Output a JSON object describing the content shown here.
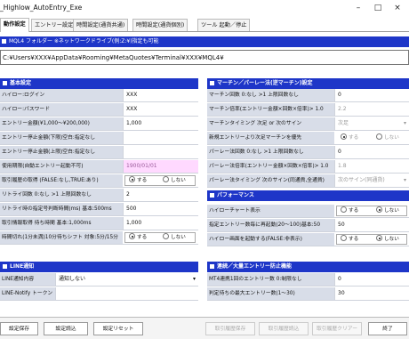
{
  "window": {
    "title": "_Highlow_AutoEntry_Exe",
    "min": "–",
    "max": "□",
    "close": "×"
  },
  "tabs": [
    "動作設定",
    "エントリー設定",
    "時間設定(通貨共通)",
    "時間設定(通貨個別)",
    "ツール 起動／停止"
  ],
  "folder": {
    "label": "MQL4 フォルダー ※ネットワークドライブ(例:Z:¥)指定も可能",
    "path": "C:¥Users¥XXX¥AppData¥Rooming¥MetaQuotes¥Terminal¥XXX¥MQL4¥"
  },
  "basic": {
    "title": "基本設定",
    "rows": [
      {
        "label": "ハイロー:ログイン",
        "value": "XXX"
      },
      {
        "label": "ハイロー:パスワード",
        "value": "XXX"
      },
      {
        "label": "エントリー金額(¥1,000〜¥200,000)",
        "value": "1,000"
      },
      {
        "label": "エントリー停止金額(下限)空白:指定なし",
        "value": ""
      },
      {
        "label": "エントリー停止金額(上限)空白:指定なし",
        "value": ""
      },
      {
        "label": "使用期限(自動エントリー起動不可)",
        "value": "1900/01/01"
      },
      {
        "label": "取引履歴の取得 (FALSE:なし,TRUE:あり)",
        "value": ""
      },
      {
        "label": "リトライ回数 0:なし >1 上限回数なし",
        "value": "2"
      },
      {
        "label": "リトライ時の指定号判断時間(ms) 基本:500ms",
        "value": "500"
      },
      {
        "label": "取引情報取得 待ち時間 基本:1,000ms",
        "value": "1,000"
      },
      {
        "label": "時間切れ(1分未満)10分待ちシフト 対象:5分/15分",
        "value": ""
      }
    ],
    "radio_on": "する",
    "radio_off": "しない"
  },
  "martingale": {
    "title": "マーチン／パーレー法(逆マーチン)設定",
    "rows": [
      {
        "label": "マーチン回数 0:なし >1 上限回数なし",
        "value": "0"
      },
      {
        "label": "マーチン倍率(エントリー金額×回数×倍率)> 1.0",
        "value": "2.2"
      },
      {
        "label": "マーチンタイミング 次足 or 次のサイン",
        "value": "次足"
      },
      {
        "label": "新規エントリーより次足マーチンを優先",
        "value": ""
      },
      {
        "label": "パーレー法回数 0:なし >1 上限回数なし",
        "value": "0"
      },
      {
        "label": "パーレー法倍率(エントリー金額×回数×倍率)> 1.0",
        "value": "1.8"
      },
      {
        "label": "パーレー法タイミング 次のサイン(同通貨,全通貨)",
        "value": "次のサイン(同通貨)"
      }
    ]
  },
  "performance": {
    "title": "パフォーマンス",
    "rows": [
      {
        "label": "ハイローチャート表示",
        "value": ""
      },
      {
        "label": "指定エントリー数毎に再起動(20〜100)基本:50",
        "value": "50"
      },
      {
        "label": "ハイロー画面を起動する(FALSE:非表示)",
        "value": ""
      }
    ]
  },
  "line": {
    "title": "LINE通知",
    "rows": [
      {
        "label": "LINE通知内容",
        "value": "通知しない"
      },
      {
        "label": "LINE-Notify トークン",
        "value": ""
      }
    ]
  },
  "consecutive": {
    "title": "連続／大量エントリー防止機能",
    "rows": [
      {
        "label": "MT4連携1回のエントリー数 0:制限なし",
        "value": "0"
      },
      {
        "label": "判定待ちの最大エントリー数(1〜30)",
        "value": "30"
      }
    ]
  },
  "buttons": [
    "設定保存",
    "設定読込",
    "設定リセット",
    "取引履歴保存",
    "取引履歴読込",
    "取引履歴クリアー",
    "終了"
  ]
}
